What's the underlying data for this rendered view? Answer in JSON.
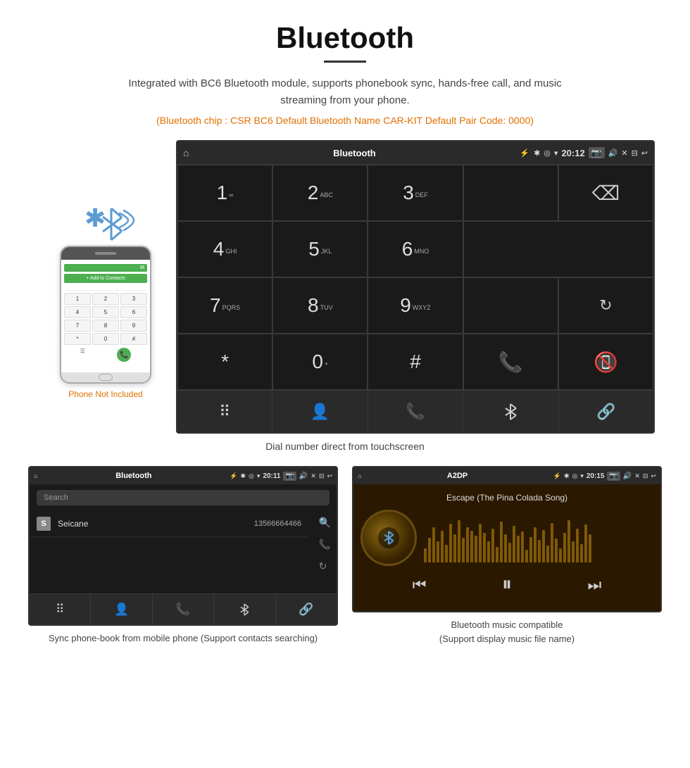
{
  "page": {
    "title": "Bluetooth",
    "subtitle": "Integrated with BC6 Bluetooth module, supports phonebook sync, hands-free call, and music streaming from your phone.",
    "tech_info": "(Bluetooth chip : CSR BC6    Default Bluetooth Name CAR-KIT    Default Pair Code: 0000)",
    "phone_not_included": "Phone Not Included",
    "main_caption": "Dial number direct from touchscreen"
  },
  "head_unit": {
    "screen_title": "Bluetooth",
    "time": "20:12",
    "usb_icon": "⚡",
    "bt_icon": "✱",
    "location_icon": "◉",
    "signal_icon": "▼",
    "keys": [
      {
        "digit": "1",
        "letters": "∞"
      },
      {
        "digit": "2",
        "letters": "ABC"
      },
      {
        "digit": "3",
        "letters": "DEF"
      },
      {
        "digit": "",
        "letters": ""
      },
      {
        "digit": "",
        "letters": "backspace"
      },
      {
        "digit": "4",
        "letters": "GHI"
      },
      {
        "digit": "5",
        "letters": "JKL"
      },
      {
        "digit": "6",
        "letters": "MNO"
      },
      {
        "digit": "",
        "letters": ""
      },
      {
        "digit": "",
        "letters": ""
      },
      {
        "digit": "7",
        "letters": "PQRS"
      },
      {
        "digit": "8",
        "letters": "TUV"
      },
      {
        "digit": "9",
        "letters": "WXYZ"
      },
      {
        "digit": "",
        "letters": ""
      },
      {
        "digit": "",
        "letters": "reload"
      },
      {
        "digit": "*",
        "letters": ""
      },
      {
        "digit": "0",
        "letters": "+"
      },
      {
        "digit": "#",
        "letters": ""
      },
      {
        "digit": "",
        "letters": "call_green"
      },
      {
        "digit": "",
        "letters": "call_red"
      }
    ],
    "toolbar": [
      "dialpad",
      "person",
      "phone",
      "bluetooth",
      "link"
    ]
  },
  "phonebook_screen": {
    "screen_title": "Bluetooth",
    "time": "20:11",
    "search_placeholder": "Search",
    "contact_letter": "S",
    "contact_name": "Seicane",
    "contact_number": "13566664466",
    "side_icons": [
      "search",
      "phone",
      "reload"
    ],
    "toolbar": [
      "dialpad",
      "person",
      "phone",
      "bluetooth",
      "link"
    ]
  },
  "music_screen": {
    "screen_title": "A2DP",
    "time": "20:15",
    "song_title": "Escape (The Pina Colada Song)",
    "controls": [
      "prev",
      "play-pause",
      "next"
    ]
  },
  "captions": {
    "phonebook": "Sync phone-book from mobile phone\n(Support contacts searching)",
    "music": "Bluetooth music compatible\n(Support display music file name)"
  }
}
